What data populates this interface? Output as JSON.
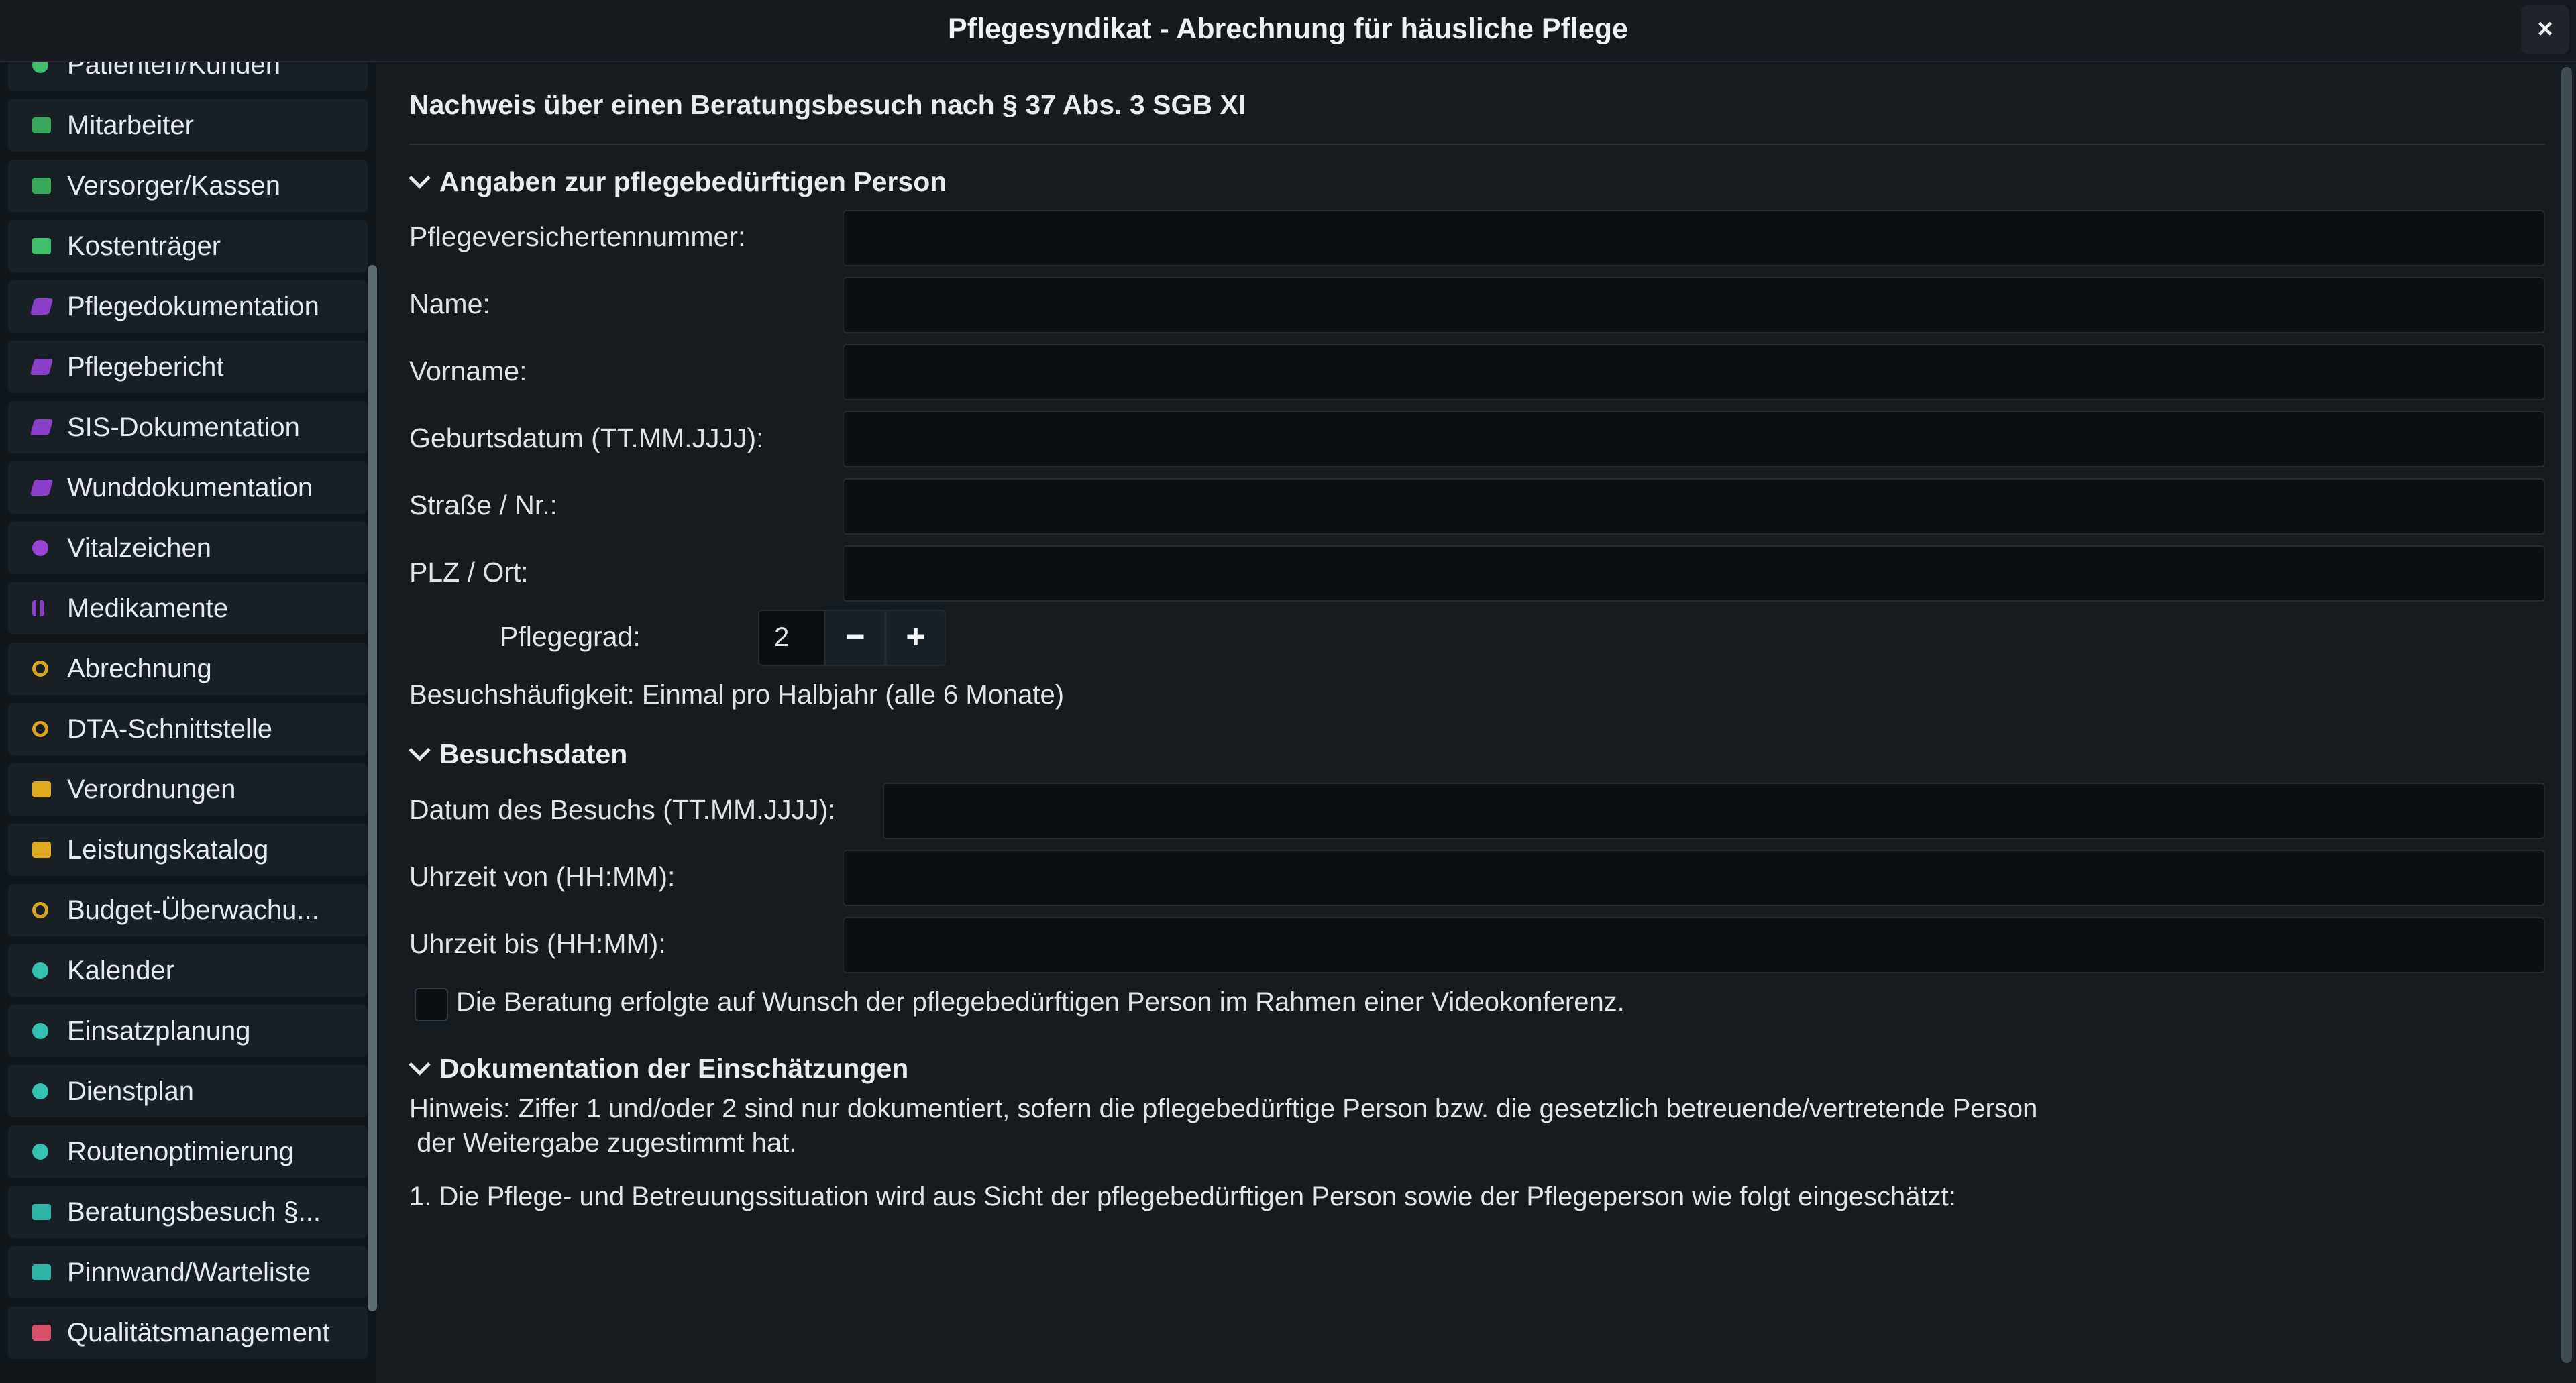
{
  "window": {
    "title": "Pflegesyndikat - Abrechnung für häusliche Pflege",
    "close_label": "×"
  },
  "sidebar": {
    "items": [
      {
        "label": "Patienten/Kunden",
        "icon": "heart-icon",
        "color": "#3fbf6a"
      },
      {
        "label": "Mitarbeiter",
        "icon": "person-icon",
        "color": "#3aa85a"
      },
      {
        "label": "Versorger/Kassen",
        "icon": "building-icon",
        "color": "#3aa85a"
      },
      {
        "label": "Kostenträger",
        "icon": "card-icon",
        "color": "#3fbf6a"
      },
      {
        "label": "Pflegedokumentation",
        "icon": "puzzle-icon",
        "color": "#8a3fc8"
      },
      {
        "label": "Pflegebericht",
        "icon": "puzzle-icon",
        "color": "#8a3fc8"
      },
      {
        "label": "SIS-Dokumentation",
        "icon": "puzzle-icon",
        "color": "#8a3fc8"
      },
      {
        "label": "Wunddokumentation",
        "icon": "puzzle-icon",
        "color": "#8a3fc8"
      },
      {
        "label": "Vitalzeichen",
        "icon": "heart-icon",
        "color": "#9b45d8"
      },
      {
        "label": "Medikamente",
        "icon": "pills-icon",
        "color": "#8a3fc8"
      },
      {
        "label": "Abrechnung",
        "icon": "coin-icon",
        "color": "#d9a520"
      },
      {
        "label": "DTA-Schnittstelle",
        "icon": "coin-icon",
        "color": "#d9a520"
      },
      {
        "label": "Verordnungen",
        "icon": "card-icon",
        "color": "#e0aa20"
      },
      {
        "label": "Leistungskatalog",
        "icon": "card-icon",
        "color": "#e0aa20"
      },
      {
        "label": "Budget-Überwachu...",
        "icon": "coin-icon",
        "color": "#d9a520"
      },
      {
        "label": "Kalender",
        "icon": "pin-icon",
        "color": "#35c1b0"
      },
      {
        "label": "Einsatzplanung",
        "icon": "pin-icon",
        "color": "#35c1b0"
      },
      {
        "label": "Dienstplan",
        "icon": "pin-icon",
        "color": "#35c1b0"
      },
      {
        "label": "Routenoptimierung",
        "icon": "pin-icon",
        "color": "#35c1b0"
      },
      {
        "label": "Beratungsbesuch §...",
        "icon": "checklist-icon",
        "color": "#2fb5a6"
      },
      {
        "label": "Pinnwand/Warteliste",
        "icon": "board-icon",
        "color": "#2fb5a6"
      },
      {
        "label": "Qualitätsmanagement",
        "icon": "card-icon",
        "color": "#d8506a"
      }
    ]
  },
  "form": {
    "heading": "Nachweis über einen Beratungsbesuch nach § 37 Abs. 3 SGB XI",
    "section1": {
      "title": "Angaben zur pflegebedürftigen Person",
      "fields": {
        "insurance_number": {
          "label": "Pflegeversichertennummer:",
          "value": ""
        },
        "name": {
          "label": "Name:",
          "value": ""
        },
        "first_name": {
          "label": "Vorname:",
          "value": ""
        },
        "birthdate": {
          "label": "Geburtsdatum (TT.MM.JJJJ):",
          "value": ""
        },
        "street": {
          "label": "Straße / Nr.:",
          "value": ""
        },
        "zip_city": {
          "label": "PLZ / Ort:",
          "value": ""
        }
      },
      "care_level": {
        "label": "Pflegegrad:",
        "value": "2",
        "minus": "−",
        "plus": "+"
      },
      "visit_frequency": "Besuchshäufigkeit: Einmal pro Halbjahr (alle 6 Monate)"
    },
    "section2": {
      "title": "Besuchsdaten",
      "fields": {
        "visit_date": {
          "label": "Datum des Besuchs (TT.MM.JJJJ):",
          "value": ""
        },
        "time_from": {
          "label": "Uhrzeit von (HH:MM):",
          "value": ""
        },
        "time_to": {
          "label": "Uhrzeit bis (HH:MM):",
          "value": ""
        }
      },
      "video_checkbox": {
        "label": "Die Beratung erfolgte auf Wunsch der pflegebedürftigen Person im Rahmen einer Videokonferenz.",
        "checked": false
      }
    },
    "section3": {
      "title": "Dokumentation der Einschätzungen",
      "hint_line1": "Hinweis: Ziffer 1 und/oder 2 sind nur dokumentiert, sofern die pflegebedürftige Person bzw. die gesetzlich betreuende/vertretende Person",
      "hint_line2": " der Weitergabe zugestimmt hat.",
      "item1": "1. Die Pflege- und Betreuungssituation wird aus Sicht der pflegebedürftigen Person sowie der Pflegeperson wie folgt eingeschätzt:"
    }
  },
  "colors": {
    "background": "#161b20",
    "sidebar": "#11161b",
    "input": "#0d1013"
  }
}
